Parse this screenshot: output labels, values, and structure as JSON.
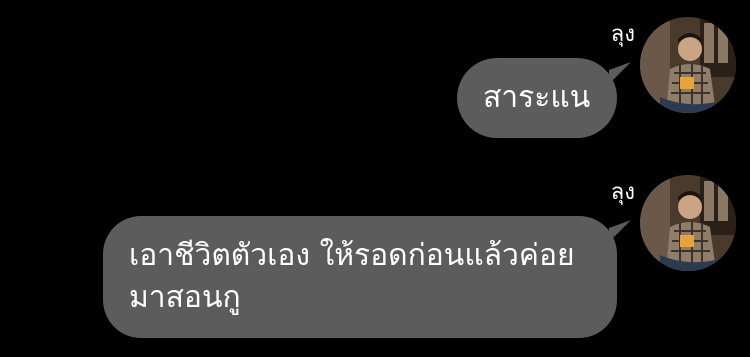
{
  "chat": {
    "messages": [
      {
        "sender": "ลุง",
        "text": "สาระแน"
      },
      {
        "sender": "ลุง",
        "text": "เอาชีวิตตัวเอง ให้รอดก่อนแล้วค่อย มาสอนกู"
      }
    ]
  },
  "colors": {
    "background": "#000000",
    "bubble": "#5c5c5c",
    "text": "#ffffff"
  },
  "icons": {
    "avatar": "profile-photo"
  }
}
